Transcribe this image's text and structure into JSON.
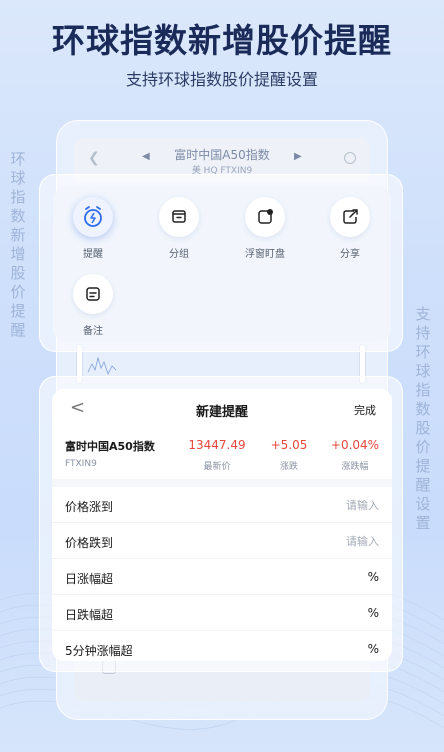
{
  "headline": "环球指数新增股价提醒",
  "subline": "支持环球指数股价提醒设置",
  "side_left": [
    "环",
    "球",
    "指",
    "数",
    "新",
    "增",
    "股",
    "价",
    "提",
    "醒"
  ],
  "side_right": [
    "支",
    "持",
    "环",
    "球",
    "指",
    "数",
    "股",
    "价",
    "提",
    "醒",
    "设",
    "置"
  ],
  "phone": {
    "title": "富时中国A50指数",
    "subtitle": "美 HQ FTXIN9"
  },
  "actions": [
    {
      "label": "提醒",
      "icon": "alarm-clock-icon",
      "active": true
    },
    {
      "label": "分组",
      "icon": "folder-icon",
      "active": false
    },
    {
      "label": "浮窗盯盘",
      "icon": "floating-window-icon",
      "active": false
    },
    {
      "label": "分享",
      "icon": "share-icon",
      "active": false
    },
    {
      "label": "备注",
      "icon": "note-icon",
      "active": false
    }
  ],
  "alert": {
    "title": "新建提醒",
    "back": "<",
    "done": "完成",
    "stock_name": "富时中国A50指数",
    "stock_code": "FTXIN9",
    "price": "13447.49",
    "price_caption": "最新价",
    "change": "+5.05",
    "change_caption": "涨跌",
    "change_pct": "+0.04%",
    "change_pct_caption": "涨跌幅",
    "rows": [
      {
        "label": "价格涨到",
        "placeholder": "请输入",
        "unit": ""
      },
      {
        "label": "价格跌到",
        "placeholder": "请输入",
        "unit": ""
      },
      {
        "label": "日涨幅超",
        "placeholder": "",
        "unit": "%"
      },
      {
        "label": "日跌幅超",
        "placeholder": "",
        "unit": "%"
      },
      {
        "label": "5分钟涨幅超",
        "placeholder": "",
        "unit": "%"
      }
    ]
  },
  "colors": {
    "headline": "#1a2b5a",
    "up": "#e8473d",
    "accent": "#2f6cf0"
  }
}
